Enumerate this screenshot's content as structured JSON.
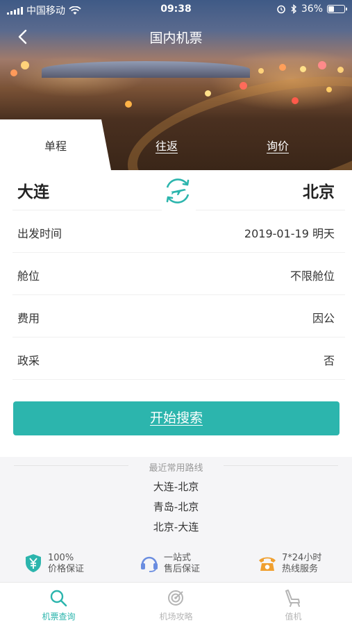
{
  "status_bar": {
    "carrier": "中国移动",
    "time": "09:38",
    "battery": "36%",
    "battery_level": 0.36
  },
  "nav": {
    "title": "国内机票"
  },
  "tabs": [
    {
      "label": "单程",
      "active": true
    },
    {
      "label": "往返",
      "active": false
    },
    {
      "label": "询价",
      "active": false
    }
  ],
  "route": {
    "from": "大连",
    "to": "北京"
  },
  "form_rows": [
    {
      "label": "出发时间",
      "value": "2019-01-19 明天"
    },
    {
      "label": "舱位",
      "value": "不限舱位"
    },
    {
      "label": "费用",
      "value": "因公"
    },
    {
      "label": "政采",
      "value": "否"
    }
  ],
  "search_button": "开始搜索",
  "recent": {
    "title": "最近常用路线",
    "routes": [
      "大连-北京",
      "青岛-北京",
      "北京-大连"
    ]
  },
  "features": [
    {
      "line1": "100%",
      "line2": "价格保证",
      "icon": "yen-shield-icon"
    },
    {
      "line1": "一站式",
      "line2": "售后保证",
      "icon": "headset-icon"
    },
    {
      "line1": "7*24小时",
      "line2": "热线服务",
      "icon": "phone-icon"
    }
  ],
  "bottom_tabs": [
    {
      "label": "机票查询",
      "icon": "search-icon",
      "active": true
    },
    {
      "label": "机场攻略",
      "icon": "target-icon",
      "active": false
    },
    {
      "label": "值机",
      "icon": "seat-icon",
      "active": false
    }
  ],
  "colors": {
    "accent": "#2cb5ad",
    "inactive": "#b5b5b5",
    "phone": "#f0a030",
    "headset": "#6a8de0"
  }
}
